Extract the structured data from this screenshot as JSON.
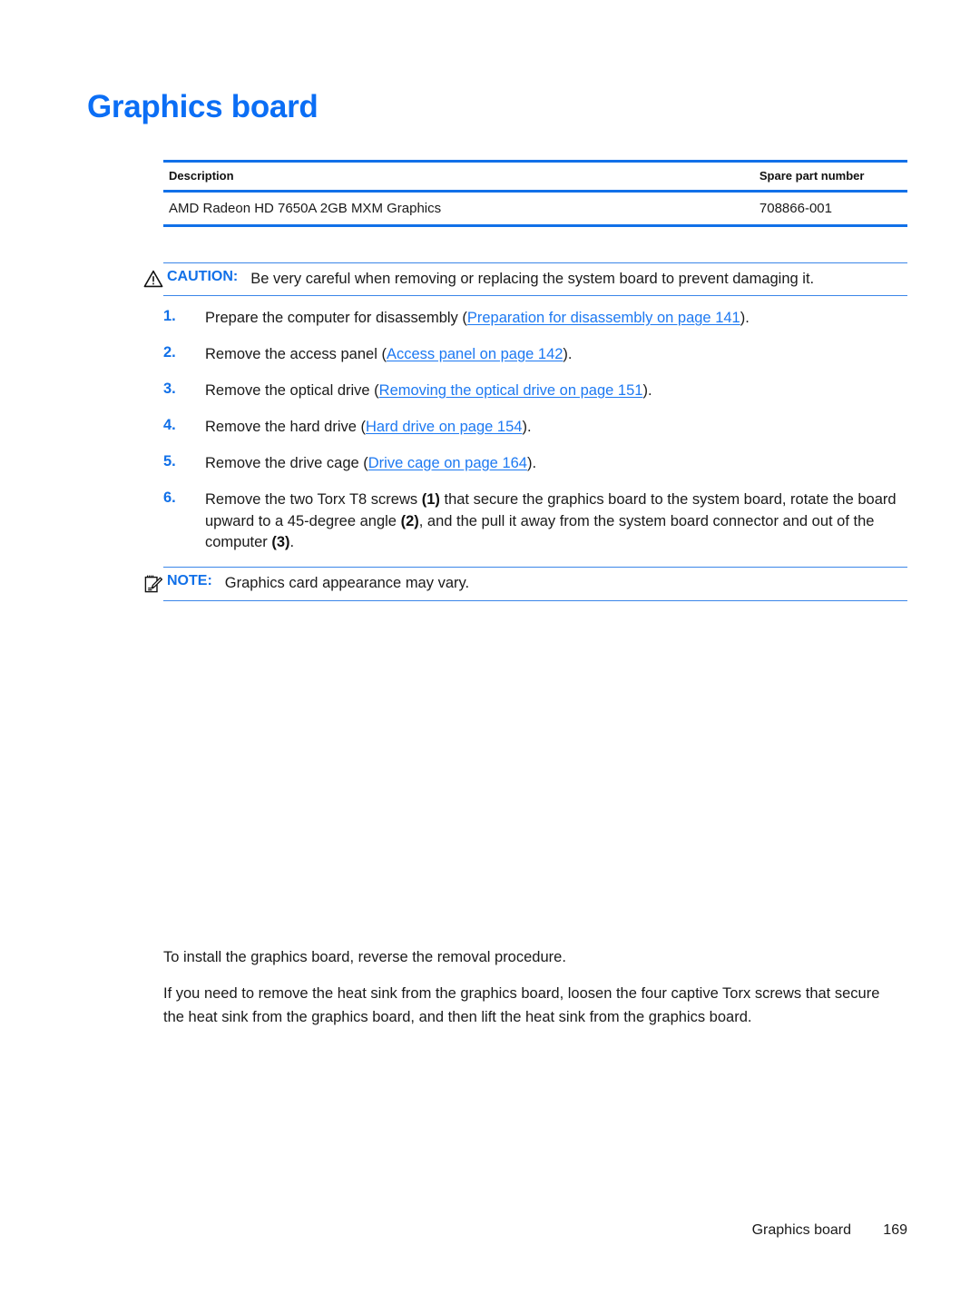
{
  "page": {
    "title": "Graphics board",
    "accent_blue": "#1170e8",
    "link_blue": "#1d79f2",
    "heading_blue": "#0b6ef5"
  },
  "parts_table": {
    "headers": {
      "description": "Description",
      "spare_part_number": "Spare part number"
    },
    "rows": [
      {
        "description": "AMD Radeon HD 7650A 2GB MXM Graphics",
        "spare_part_number": "708866-001"
      }
    ]
  },
  "caution": {
    "icon": "warning-triangle-icon",
    "label": "CAUTION:",
    "text": "Be very careful when removing or replacing the system board to prevent damaging it."
  },
  "steps": [
    {
      "number": "1.",
      "lead": "Prepare the computer for disassembly (",
      "link": "Preparation for disassembly on page 141",
      "tail": ")."
    },
    {
      "number": "2.",
      "lead": "Remove the access panel (",
      "link": "Access panel on page 142",
      "tail": ")."
    },
    {
      "number": "3.",
      "lead": "Remove the optical drive (",
      "link": "Removing the optical drive on page 151",
      "tail": ")."
    },
    {
      "number": "4.",
      "lead": "Remove the hard drive (",
      "link": "Hard drive on page 154",
      "tail": ")."
    },
    {
      "number": "5.",
      "lead": "Remove the drive cage (",
      "link": "Drive cage on page 164",
      "tail": ")."
    }
  ],
  "step6": {
    "number": "6.",
    "seg1": "Remove the two Torx T8 screws ",
    "callout1": "(1)",
    "seg2": " that secure the graphics board to the system board, rotate the board upward to a 45-degree angle ",
    "callout2": "(2)",
    "seg3": ", and the pull it away from the system board connector and out of the computer ",
    "callout3": "(3)",
    "seg4": "."
  },
  "note": {
    "icon": "notepad-pencil-icon",
    "label": "NOTE:",
    "text": "Graphics card appearance may vary."
  },
  "paragraphs": {
    "install": "To install the graphics board, reverse the removal procedure.",
    "heatsink": "If you need to remove the heat sink from the graphics board, loosen the four captive Torx screws that secure the heat sink from the graphics board, and then lift the heat sink from the graphics board."
  },
  "footer": {
    "section_title": "Graphics board",
    "page_number": "169"
  }
}
